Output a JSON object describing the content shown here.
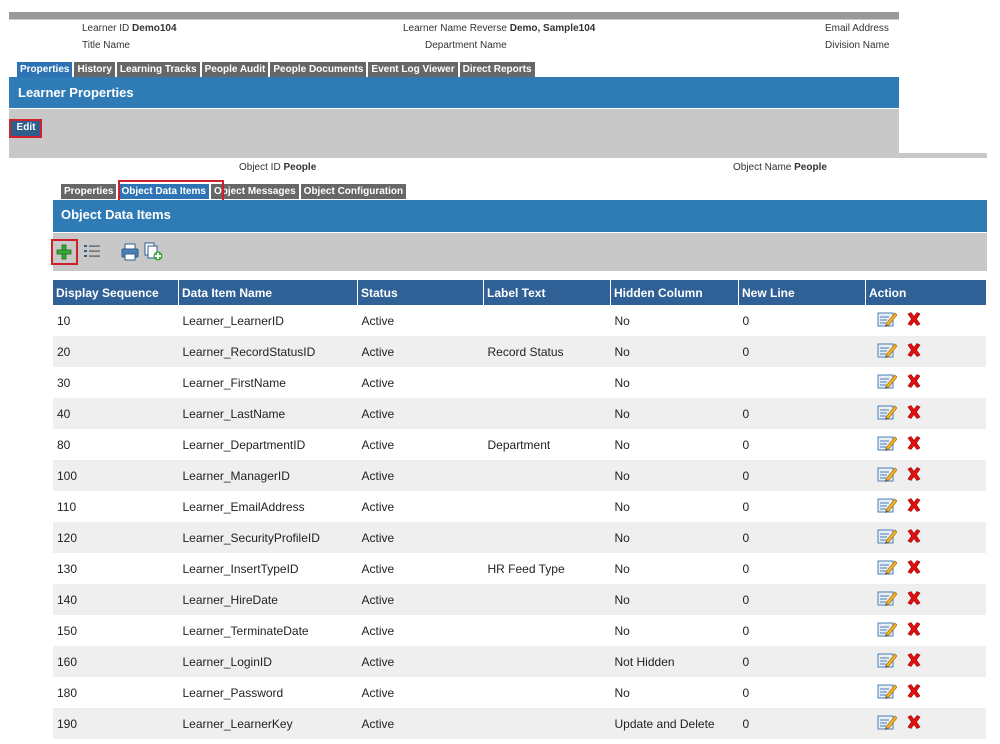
{
  "learner": {
    "id_label": "Learner ID",
    "id_value": "Demo104",
    "name_label": "Learner Name Reverse",
    "name_value": "Demo, Sample104",
    "email_label": "Email Address",
    "title_label": "Title Name",
    "department_label": "Department Name",
    "division_label": "Division Name"
  },
  "learner_tabs": [
    "Properties",
    "History",
    "Learning Tracks",
    "People Audit",
    "People Documents",
    "Event Log Viewer",
    "Direct Reports"
  ],
  "learner_section_title": "Learner Properties",
  "edit_label": "Edit",
  "object": {
    "id_label": "Object ID",
    "id_value": "People",
    "name_label": "Object Name",
    "name_value": "People"
  },
  "object_tabs": [
    "Properties",
    "Object Data Items",
    "Object Messages",
    "Object Configuration"
  ],
  "object_section_title": "Object Data Items",
  "toolbar_icons": [
    "add-icon",
    "list-icon",
    "print-icon",
    "copy-add-icon"
  ],
  "table": {
    "columns": [
      "Display Sequence",
      "Data Item Name",
      "Status",
      "Label Text",
      "Hidden Column",
      "New Line",
      "Action"
    ],
    "rows": [
      [
        "10",
        "Learner_LearnerID",
        "Active",
        "",
        "No",
        "0"
      ],
      [
        "20",
        "Learner_RecordStatusID",
        "Active",
        "Record Status",
        "No",
        "0"
      ],
      [
        "30",
        "Learner_FirstName",
        "Active",
        "",
        "No",
        ""
      ],
      [
        "40",
        "Learner_LastName",
        "Active",
        "",
        "No",
        "0"
      ],
      [
        "80",
        "Learner_DepartmentID",
        "Active",
        "Department",
        "No",
        "0"
      ],
      [
        "100",
        "Learner_ManagerID",
        "Active",
        "",
        "No",
        "0"
      ],
      [
        "110",
        "Learner_EmailAddress",
        "Active",
        "",
        "No",
        "0"
      ],
      [
        "120",
        "Learner_SecurityProfileID",
        "Active",
        "",
        "No",
        "0"
      ],
      [
        "130",
        "Learner_InsertTypeID",
        "Active",
        "HR Feed Type",
        "No",
        "0"
      ],
      [
        "140",
        "Learner_HireDate",
        "Active",
        "",
        "No",
        "0"
      ],
      [
        "150",
        "Learner_TerminateDate",
        "Active",
        "",
        "No",
        "0"
      ],
      [
        "160",
        "Learner_LoginID",
        "Active",
        "",
        "Not Hidden",
        "0"
      ],
      [
        "180",
        "Learner_Password",
        "Active",
        "",
        "No",
        "0"
      ],
      [
        "190",
        "Learner_LearnerKey",
        "Active",
        "",
        "Update and Delete",
        "0"
      ]
    ]
  },
  "colors": {
    "header_blue": "#2e7bb5",
    "table_header": "#2f6096",
    "tab_gray": "#676767",
    "highlight_red": "#d1202b"
  }
}
